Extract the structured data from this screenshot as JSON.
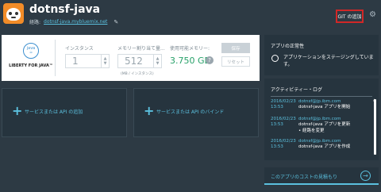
{
  "app": {
    "name": "dotnsf-java",
    "route_prefix": "経路:",
    "route_url": "dotnsf-java.mybluemix.net"
  },
  "header": {
    "git_button": "GIT の追加"
  },
  "runtime": {
    "badge_text": "java",
    "name": "LIBERTY FOR JAVA™",
    "instances_label": "インスタンス",
    "instances_value": "1",
    "memory_label": "メモリー割り当て量...",
    "memory_value": "512",
    "memory_note": "(MB / インスタンス)",
    "available_label": "使用可能メモリー:",
    "available_value": "3.750 GB",
    "save_label": "保存",
    "reset_label": "リセット"
  },
  "tiles": {
    "add_service": "サービスまたは API の追加",
    "bind_service": "サービスまたは API のバインド"
  },
  "health": {
    "title": "アプリの正常性",
    "message": "アプリケーションをステージングしています。"
  },
  "activity": {
    "title": "アクティビティー・ログ",
    "items": [
      {
        "date": "2016/02/23",
        "time": "13:53",
        "user": "dotnsf@jp.ibm.com",
        "desc": "dotnsf-java アプリを開始",
        "desc2": ""
      },
      {
        "date": "2016/02/23",
        "time": "13:53",
        "user": "dotnsf@jp.ibm.com",
        "desc": "dotnsf-java アプリを更新",
        "desc2": "• 経路を変更"
      },
      {
        "date": "2016/02/23",
        "time": "13:53",
        "user": "dotnsf@jp.ibm.com",
        "desc": "dotnsf-java アプリを作成",
        "desc2": ""
      }
    ]
  },
  "cost": {
    "label": "このアプリのコストの見積もり"
  },
  "colors": {
    "background": "#2d3a44",
    "panel": "#26343e",
    "accent": "#5bc0de",
    "highlight_border": "#d12727",
    "available_green": "#27a169"
  },
  "icons": {
    "app": "robot-face-icon",
    "edit": "pencil-icon",
    "settings": "gear-icon",
    "help": "question-icon",
    "health": "circle-status-icon",
    "cost": "arrow-right-circle-icon"
  }
}
